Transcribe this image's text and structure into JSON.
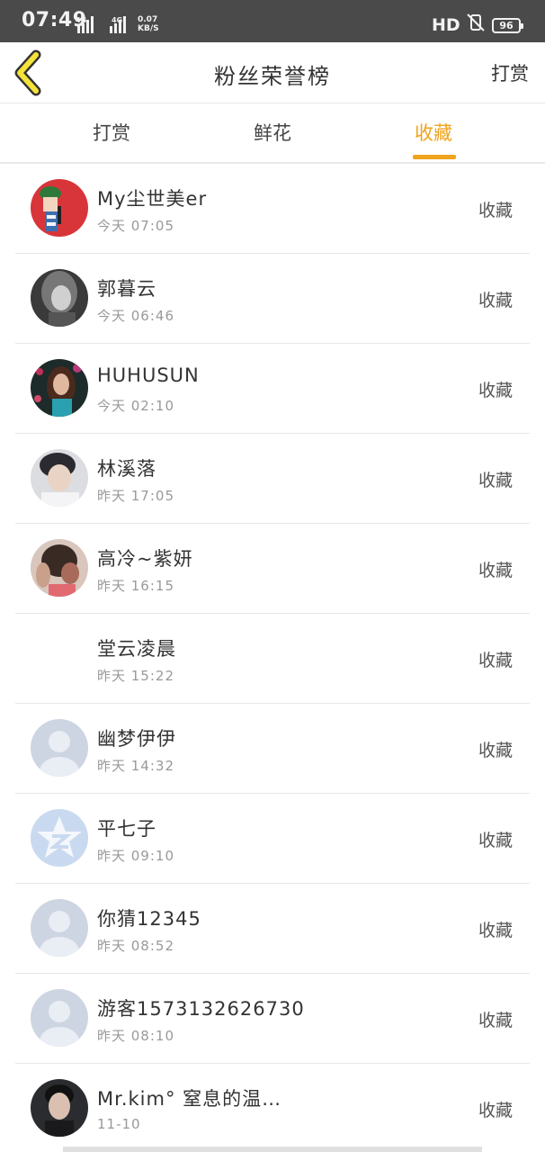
{
  "status_bar": {
    "time": "07:49",
    "signal1": "4G",
    "signal2": "4G",
    "speed_value": "0.07",
    "speed_unit": "KB/S",
    "hd": "HD",
    "battery": "96"
  },
  "header": {
    "title": "粉丝荣誉榜",
    "right_link": "打赏",
    "back_icon": "chevron-left-icon"
  },
  "tabs": [
    {
      "label": "打赏",
      "active": false
    },
    {
      "label": "鲜花",
      "active": false
    },
    {
      "label": "收藏",
      "active": true
    }
  ],
  "colors": {
    "accent": "#f0a31c",
    "statusbar": "#4a4a4a",
    "back_icon_fill": "#f5e23a"
  },
  "rows": [
    {
      "name": "My尘世美er",
      "time": "今天 07:05",
      "action": "收藏",
      "avatar": "cartoon-avatar"
    },
    {
      "name": "郭暮云",
      "time": "今天 06:46",
      "action": "收藏",
      "avatar": "bw-portrait-avatar"
    },
    {
      "name": "HUHUSUN",
      "time": "今天 02:10",
      "action": "收藏",
      "avatar": "photo-avatar"
    },
    {
      "name": "林溪落",
      "time": "昨天 17:05",
      "action": "收藏",
      "avatar": "photo-avatar"
    },
    {
      "name": "高冷~紫妍",
      "time": "昨天 16:15",
      "action": "收藏",
      "avatar": "photo-avatar"
    },
    {
      "name": "堂云凌晨",
      "time": "昨天 15:22",
      "action": "收藏",
      "avatar": "none"
    },
    {
      "name": "幽梦伊伊",
      "time": "昨天 14:32",
      "action": "收藏",
      "avatar": "default-user-avatar"
    },
    {
      "name": "平七子",
      "time": "昨天 09:10",
      "action": "收藏",
      "avatar": "qzone-star-avatar"
    },
    {
      "name": "你猜12345",
      "time": "昨天 08:52",
      "action": "收藏",
      "avatar": "default-user-avatar"
    },
    {
      "name": "游客15731326267​30",
      "time": "昨天 08:10",
      "action": "收藏",
      "avatar": "default-user-avatar"
    },
    {
      "name": "Mr.kim° 窒息的温…",
      "time": "11-10",
      "action": "收藏",
      "avatar": "photo-avatar"
    }
  ]
}
